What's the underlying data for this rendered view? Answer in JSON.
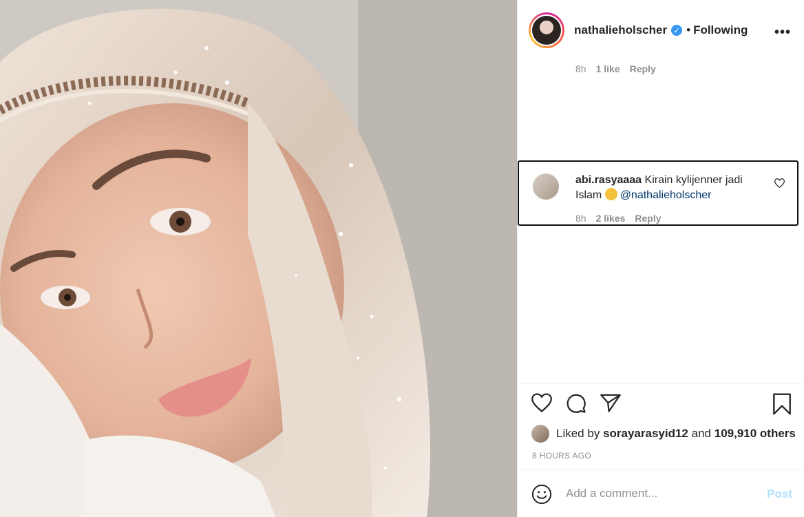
{
  "post": {
    "photo_icon": "photo-selfie-hijab",
    "author": {
      "username": "nathalieholscher",
      "verified_icon": "verified-badge-icon",
      "separator": "•",
      "follow_status": "Following"
    },
    "more_icon": "more-options-icon"
  },
  "comments": {
    "previous_meta": {
      "time": "8h",
      "likes": "1 like",
      "reply": "Reply"
    },
    "highlighted": {
      "username": "abi.rasyaaaa",
      "text_before": "Kirain kylijenner jadi Islam",
      "emoji": "rofl-emoji",
      "mention": "@nathalieholscher",
      "time": "8h",
      "likes": "2 likes",
      "reply": "Reply"
    }
  },
  "actions": {
    "like_icon": "heart-icon",
    "comment_icon": "comment-icon",
    "share_icon": "share-icon",
    "save_icon": "bookmark-icon"
  },
  "likes": {
    "prefix": "Liked by",
    "user": "sorayarasyid12",
    "connector": "and",
    "count": "109,910 others"
  },
  "timestamp": "8 HOURS AGO",
  "add_comment": {
    "placeholder": "Add a comment...",
    "post_label": "Post"
  },
  "colors": {
    "link": "#00376b",
    "verified": "#3897f0",
    "post_disabled": "#b2dffc",
    "meta": "#8e8e8e"
  }
}
